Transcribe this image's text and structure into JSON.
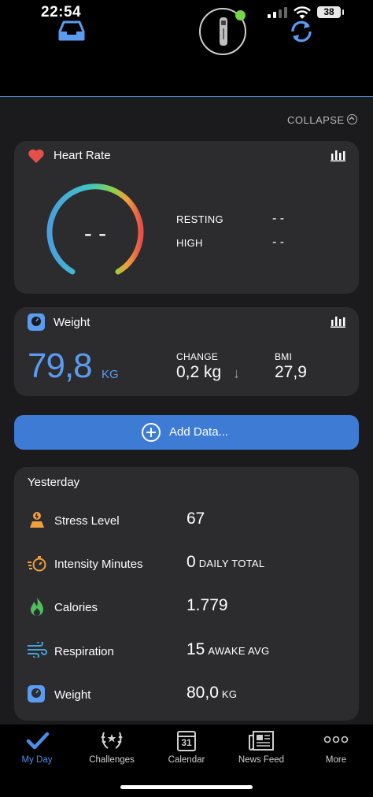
{
  "status_bar": {
    "time": "22:54",
    "battery": "38"
  },
  "toolbar": {
    "collapse_label": "COLLAPSE"
  },
  "heart_rate": {
    "title": "Heart Rate",
    "gauge_value": "- -",
    "rows": [
      {
        "label": "RESTING",
        "value": "- -"
      },
      {
        "label": "HIGH",
        "value": "- -"
      }
    ]
  },
  "weight_card": {
    "title": "Weight",
    "value": "79,8",
    "unit": "KG",
    "change_label": "CHANGE",
    "change_value": "0,2 kg",
    "change_arrow": "↓",
    "bmi_label": "BMI",
    "bmi_value": "27,9"
  },
  "add_data": {
    "label": "Add Data..."
  },
  "yesterday": {
    "title": "Yesterday",
    "rows": [
      {
        "icon": "stress-icon",
        "label": "Stress Level",
        "value": "67",
        "unit": ""
      },
      {
        "icon": "stopwatch-icon",
        "label": "Intensity Minutes",
        "value": "0",
        "unit": "DAILY TOTAL"
      },
      {
        "icon": "flame-icon",
        "label": "Calories",
        "value": "1.779",
        "unit": ""
      },
      {
        "icon": "wind-icon",
        "label": "Respiration",
        "value": "15",
        "unit": "AWAKE AVG"
      },
      {
        "icon": "scale-icon",
        "label": "Weight",
        "value": "80,0",
        "unit": "KG"
      }
    ]
  },
  "nav": {
    "items": [
      {
        "label": "My Day",
        "active": true
      },
      {
        "label": "Challenges",
        "active": false
      },
      {
        "label": "Calendar",
        "active": false,
        "badge": "31"
      },
      {
        "label": "News Feed",
        "active": false
      },
      {
        "label": "More",
        "active": false
      }
    ]
  },
  "colors": {
    "accent": "#3d7bd4",
    "heart": "#e5504a",
    "weight_blue": "#5b9bf0",
    "stress_orange": "#f0a03c",
    "calories_green": "#4fbf5a",
    "respiration_blue": "#4aa3d8"
  }
}
